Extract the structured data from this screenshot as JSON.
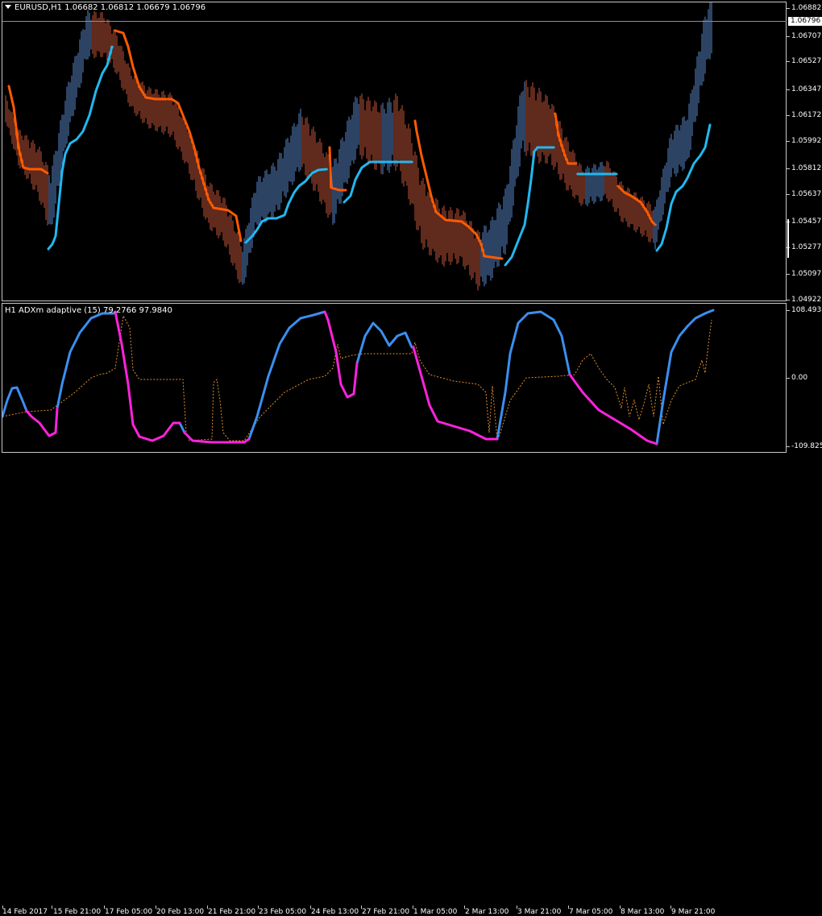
{
  "main_chart": {
    "title": "EURUSD,H1  1.06682 1.06812 1.06679 1.06796",
    "bid_price": "1.06796",
    "price_labels": [
      "1.06882",
      "1.06707",
      "1.06527",
      "1.06347",
      "1.06172",
      "1.05992",
      "1.05812",
      "1.05637",
      "1.05457",
      "1.05277",
      "1.05097",
      "1.04922"
    ],
    "colors": {
      "bull_bar": "#5a86c8",
      "bear_bar": "#c0553a",
      "up_line": "#22b8f0",
      "down_line": "#ff5a00",
      "frame": "#c8c8c8"
    }
  },
  "indicator": {
    "title": "H1 ADXm adaptive (15) 79.2766 97.9840",
    "level_labels": [
      "108.4938",
      "0.00",
      "-109.8259"
    ],
    "colors": {
      "up": "#3b8ff0",
      "down": "#ff22dd",
      "dotted": "#e0902a"
    }
  },
  "time_axis": {
    "labels": [
      "14 Feb 2017",
      "15 Feb 21:00",
      "17 Feb 05:00",
      "20 Feb 13:00",
      "21 Feb 21:00",
      "23 Feb 05:00",
      "24 Feb 13:00",
      "27 Feb 21:00",
      "1 Mar 05:00",
      "2 Mar 13:00",
      "3 Mar 21:00",
      "7 Mar 05:00",
      "8 Mar 13:00",
      "9 Mar 21:00"
    ]
  }
}
